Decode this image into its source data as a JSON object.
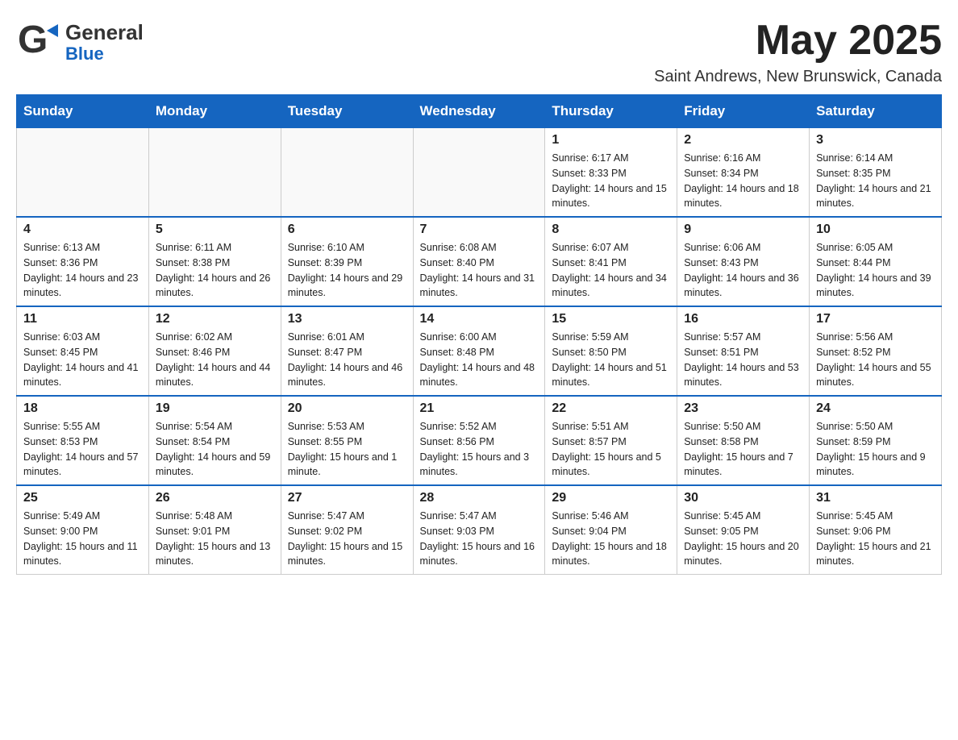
{
  "header": {
    "logo": {
      "general": "General",
      "blue": "Blue",
      "arrow": "▶"
    },
    "month_title": "May 2025",
    "location": "Saint Andrews, New Brunswick, Canada"
  },
  "days_of_week": [
    "Sunday",
    "Monday",
    "Tuesday",
    "Wednesday",
    "Thursday",
    "Friday",
    "Saturday"
  ],
  "weeks": [
    {
      "days": [
        {
          "number": "",
          "info": ""
        },
        {
          "number": "",
          "info": ""
        },
        {
          "number": "",
          "info": ""
        },
        {
          "number": "",
          "info": ""
        },
        {
          "number": "1",
          "info": "Sunrise: 6:17 AM\nSunset: 8:33 PM\nDaylight: 14 hours and 15 minutes."
        },
        {
          "number": "2",
          "info": "Sunrise: 6:16 AM\nSunset: 8:34 PM\nDaylight: 14 hours and 18 minutes."
        },
        {
          "number": "3",
          "info": "Sunrise: 6:14 AM\nSunset: 8:35 PM\nDaylight: 14 hours and 21 minutes."
        }
      ]
    },
    {
      "days": [
        {
          "number": "4",
          "info": "Sunrise: 6:13 AM\nSunset: 8:36 PM\nDaylight: 14 hours and 23 minutes."
        },
        {
          "number": "5",
          "info": "Sunrise: 6:11 AM\nSunset: 8:38 PM\nDaylight: 14 hours and 26 minutes."
        },
        {
          "number": "6",
          "info": "Sunrise: 6:10 AM\nSunset: 8:39 PM\nDaylight: 14 hours and 29 minutes."
        },
        {
          "number": "7",
          "info": "Sunrise: 6:08 AM\nSunset: 8:40 PM\nDaylight: 14 hours and 31 minutes."
        },
        {
          "number": "8",
          "info": "Sunrise: 6:07 AM\nSunset: 8:41 PM\nDaylight: 14 hours and 34 minutes."
        },
        {
          "number": "9",
          "info": "Sunrise: 6:06 AM\nSunset: 8:43 PM\nDaylight: 14 hours and 36 minutes."
        },
        {
          "number": "10",
          "info": "Sunrise: 6:05 AM\nSunset: 8:44 PM\nDaylight: 14 hours and 39 minutes."
        }
      ]
    },
    {
      "days": [
        {
          "number": "11",
          "info": "Sunrise: 6:03 AM\nSunset: 8:45 PM\nDaylight: 14 hours and 41 minutes."
        },
        {
          "number": "12",
          "info": "Sunrise: 6:02 AM\nSunset: 8:46 PM\nDaylight: 14 hours and 44 minutes."
        },
        {
          "number": "13",
          "info": "Sunrise: 6:01 AM\nSunset: 8:47 PM\nDaylight: 14 hours and 46 minutes."
        },
        {
          "number": "14",
          "info": "Sunrise: 6:00 AM\nSunset: 8:48 PM\nDaylight: 14 hours and 48 minutes."
        },
        {
          "number": "15",
          "info": "Sunrise: 5:59 AM\nSunset: 8:50 PM\nDaylight: 14 hours and 51 minutes."
        },
        {
          "number": "16",
          "info": "Sunrise: 5:57 AM\nSunset: 8:51 PM\nDaylight: 14 hours and 53 minutes."
        },
        {
          "number": "17",
          "info": "Sunrise: 5:56 AM\nSunset: 8:52 PM\nDaylight: 14 hours and 55 minutes."
        }
      ]
    },
    {
      "days": [
        {
          "number": "18",
          "info": "Sunrise: 5:55 AM\nSunset: 8:53 PM\nDaylight: 14 hours and 57 minutes."
        },
        {
          "number": "19",
          "info": "Sunrise: 5:54 AM\nSunset: 8:54 PM\nDaylight: 14 hours and 59 minutes."
        },
        {
          "number": "20",
          "info": "Sunrise: 5:53 AM\nSunset: 8:55 PM\nDaylight: 15 hours and 1 minute."
        },
        {
          "number": "21",
          "info": "Sunrise: 5:52 AM\nSunset: 8:56 PM\nDaylight: 15 hours and 3 minutes."
        },
        {
          "number": "22",
          "info": "Sunrise: 5:51 AM\nSunset: 8:57 PM\nDaylight: 15 hours and 5 minutes."
        },
        {
          "number": "23",
          "info": "Sunrise: 5:50 AM\nSunset: 8:58 PM\nDaylight: 15 hours and 7 minutes."
        },
        {
          "number": "24",
          "info": "Sunrise: 5:50 AM\nSunset: 8:59 PM\nDaylight: 15 hours and 9 minutes."
        }
      ]
    },
    {
      "days": [
        {
          "number": "25",
          "info": "Sunrise: 5:49 AM\nSunset: 9:00 PM\nDaylight: 15 hours and 11 minutes."
        },
        {
          "number": "26",
          "info": "Sunrise: 5:48 AM\nSunset: 9:01 PM\nDaylight: 15 hours and 13 minutes."
        },
        {
          "number": "27",
          "info": "Sunrise: 5:47 AM\nSunset: 9:02 PM\nDaylight: 15 hours and 15 minutes."
        },
        {
          "number": "28",
          "info": "Sunrise: 5:47 AM\nSunset: 9:03 PM\nDaylight: 15 hours and 16 minutes."
        },
        {
          "number": "29",
          "info": "Sunrise: 5:46 AM\nSunset: 9:04 PM\nDaylight: 15 hours and 18 minutes."
        },
        {
          "number": "30",
          "info": "Sunrise: 5:45 AM\nSunset: 9:05 PM\nDaylight: 15 hours and 20 minutes."
        },
        {
          "number": "31",
          "info": "Sunrise: 5:45 AM\nSunset: 9:06 PM\nDaylight: 15 hours and 21 minutes."
        }
      ]
    }
  ]
}
